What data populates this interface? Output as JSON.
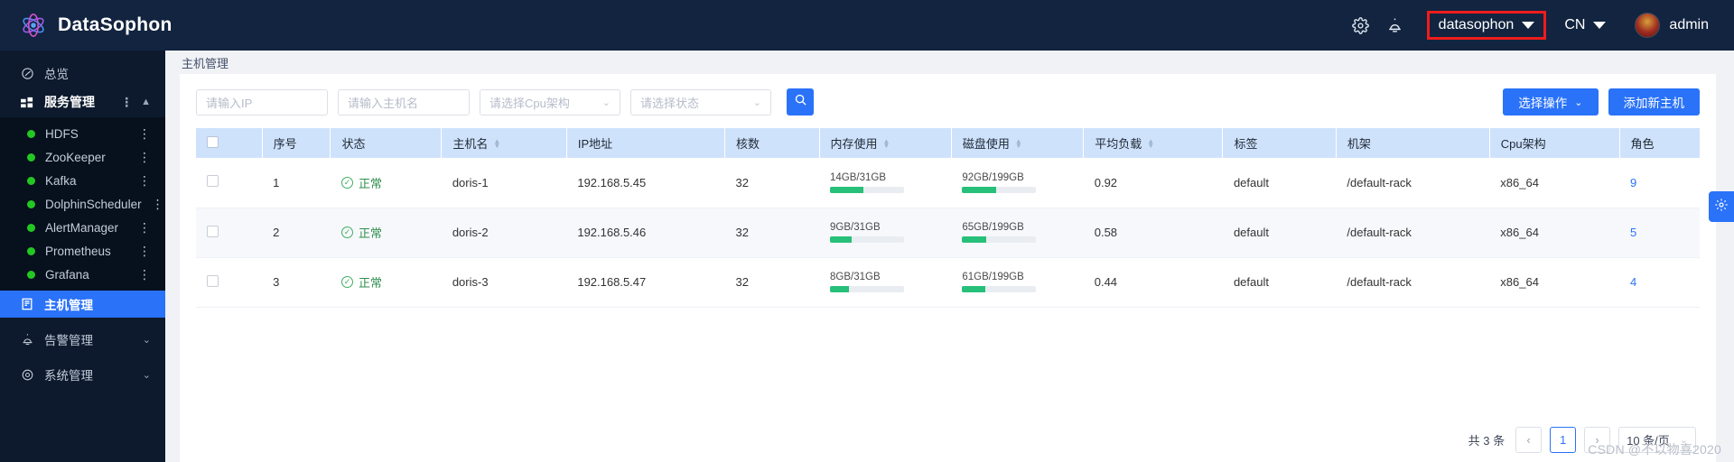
{
  "header": {
    "brand": "DataSophon",
    "logo_icon": "atom-icon",
    "settings_icon": "gear-icon",
    "alarm_icon": "alarm-lamp-icon",
    "tenant": "datasophon",
    "language": "CN",
    "user": "admin",
    "avatar_icon": "avatar"
  },
  "sidebar": {
    "overview": {
      "label": "总览",
      "icon": "dashboard-icon"
    },
    "service_group": {
      "label": "服务管理",
      "icon": "service-grid-icon",
      "more": "⋮",
      "chevron": "▲"
    },
    "services": [
      {
        "label": "HDFS",
        "status": "green",
        "more": "⋮"
      },
      {
        "label": "ZooKeeper",
        "status": "green",
        "more": "⋮"
      },
      {
        "label": "Kafka",
        "status": "green",
        "more": "⋮"
      },
      {
        "label": "DolphinScheduler",
        "status": "green",
        "more": "⋮"
      },
      {
        "label": "AlertManager",
        "status": "green",
        "more": "⋮"
      },
      {
        "label": "Prometheus",
        "status": "green",
        "more": "⋮"
      },
      {
        "label": "Grafana",
        "status": "green",
        "more": "⋮"
      }
    ],
    "host_mgmt": {
      "label": "主机管理",
      "icon": "server-icon"
    },
    "alarm_mgmt": {
      "label": "告警管理",
      "icon": "alarm-lamp-icon",
      "chevron": "⌄"
    },
    "system_mgmt": {
      "label": "系统管理",
      "icon": "gear-icon",
      "chevron": "⌄"
    }
  },
  "breadcrumb": "主机管理",
  "filters": {
    "ip_placeholder": "请输入IP",
    "hostname_placeholder": "请输入主机名",
    "cpu_arch_placeholder": "请选择Cpu架构",
    "status_placeholder": "请选择状态",
    "search_icon": "search-icon",
    "select_action_label": "选择操作",
    "add_host_label": "添加新主机"
  },
  "table": {
    "columns": [
      {
        "label": "",
        "sortable": false
      },
      {
        "label": "序号",
        "sortable": false
      },
      {
        "label": "状态",
        "sortable": false
      },
      {
        "label": "主机名",
        "sortable": true
      },
      {
        "label": "IP地址",
        "sortable": false
      },
      {
        "label": "核数",
        "sortable": false
      },
      {
        "label": "内存使用",
        "sortable": true
      },
      {
        "label": "磁盘使用",
        "sortable": true
      },
      {
        "label": "平均负载",
        "sortable": true
      },
      {
        "label": "标签",
        "sortable": false
      },
      {
        "label": "机架",
        "sortable": false
      },
      {
        "label": "Cpu架构",
        "sortable": false
      },
      {
        "label": "角色",
        "sortable": false
      }
    ],
    "rows": [
      {
        "index": "1",
        "status": "正常",
        "hostname": "doris-1",
        "ip": "192.168.5.45",
        "cores": "32",
        "mem_text": "14GB/31GB",
        "mem_pct": 45,
        "disk_text": "92GB/199GB",
        "disk_pct": 46,
        "load": "0.92",
        "tag": "default",
        "rack": "/default-rack",
        "arch": "x86_64",
        "roles": "9"
      },
      {
        "index": "2",
        "status": "正常",
        "hostname": "doris-2",
        "ip": "192.168.5.46",
        "cores": "32",
        "mem_text": "9GB/31GB",
        "mem_pct": 29,
        "disk_text": "65GB/199GB",
        "disk_pct": 33,
        "load": "0.58",
        "tag": "default",
        "rack": "/default-rack",
        "arch": "x86_64",
        "roles": "5"
      },
      {
        "index": "3",
        "status": "正常",
        "hostname": "doris-3",
        "ip": "192.168.5.47",
        "cores": "32",
        "mem_text": "8GB/31GB",
        "mem_pct": 26,
        "disk_text": "61GB/199GB",
        "disk_pct": 31,
        "load": "0.44",
        "tag": "default",
        "rack": "/default-rack",
        "arch": "x86_64",
        "roles": "4"
      }
    ]
  },
  "pagination": {
    "total": "共 3 条",
    "prev": "‹",
    "current": "1",
    "next": "›",
    "page_size": "10 条/页"
  },
  "float_gear_icon": "gear-icon",
  "watermark": "CSDN @不以物喜2020",
  "colors": {
    "accent": "#2a72f8",
    "header_bg": "#12243f",
    "sidebar_bg": "#0d1a2d",
    "ok_green": "#3fae63",
    "bar_green": "#27c07a",
    "highlight_red": "#ef1c1c",
    "table_head": "#cfe2fb"
  }
}
